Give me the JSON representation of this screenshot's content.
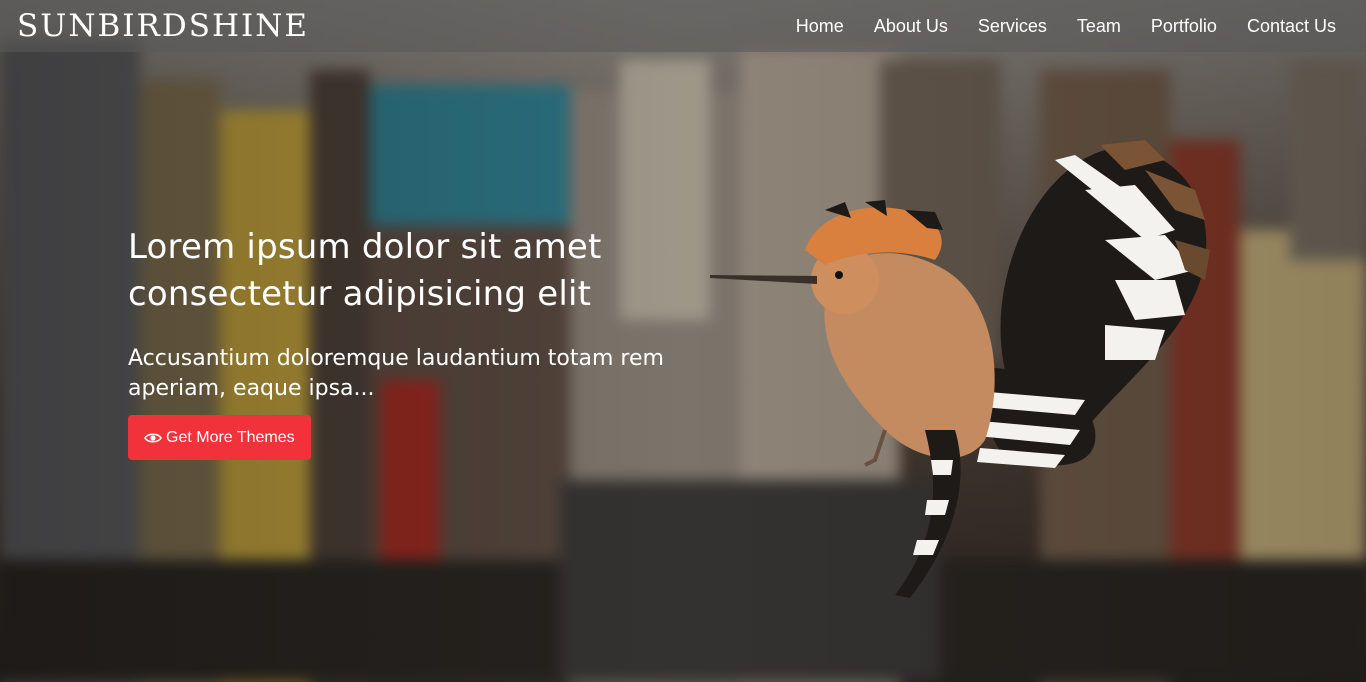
{
  "brand": "SUNBIRDSHINE",
  "nav": {
    "items": [
      {
        "label": "Home"
      },
      {
        "label": "About Us"
      },
      {
        "label": "Services"
      },
      {
        "label": "Team"
      },
      {
        "label": "Portfolio"
      },
      {
        "label": "Contact Us"
      }
    ]
  },
  "hero": {
    "headline": "Lorem ipsum dolor sit amet consectetur adipisicing elit",
    "subtext": "Accusantium doloremque laudantium totam rem aperiam, eaque ipsa...",
    "cta_label": "Get More Themes",
    "cta_icon": "eye-icon"
  },
  "colors": {
    "cta": "#f2323b",
    "navbar": "rgba(90,90,90,0.55)",
    "text": "#ffffff"
  }
}
